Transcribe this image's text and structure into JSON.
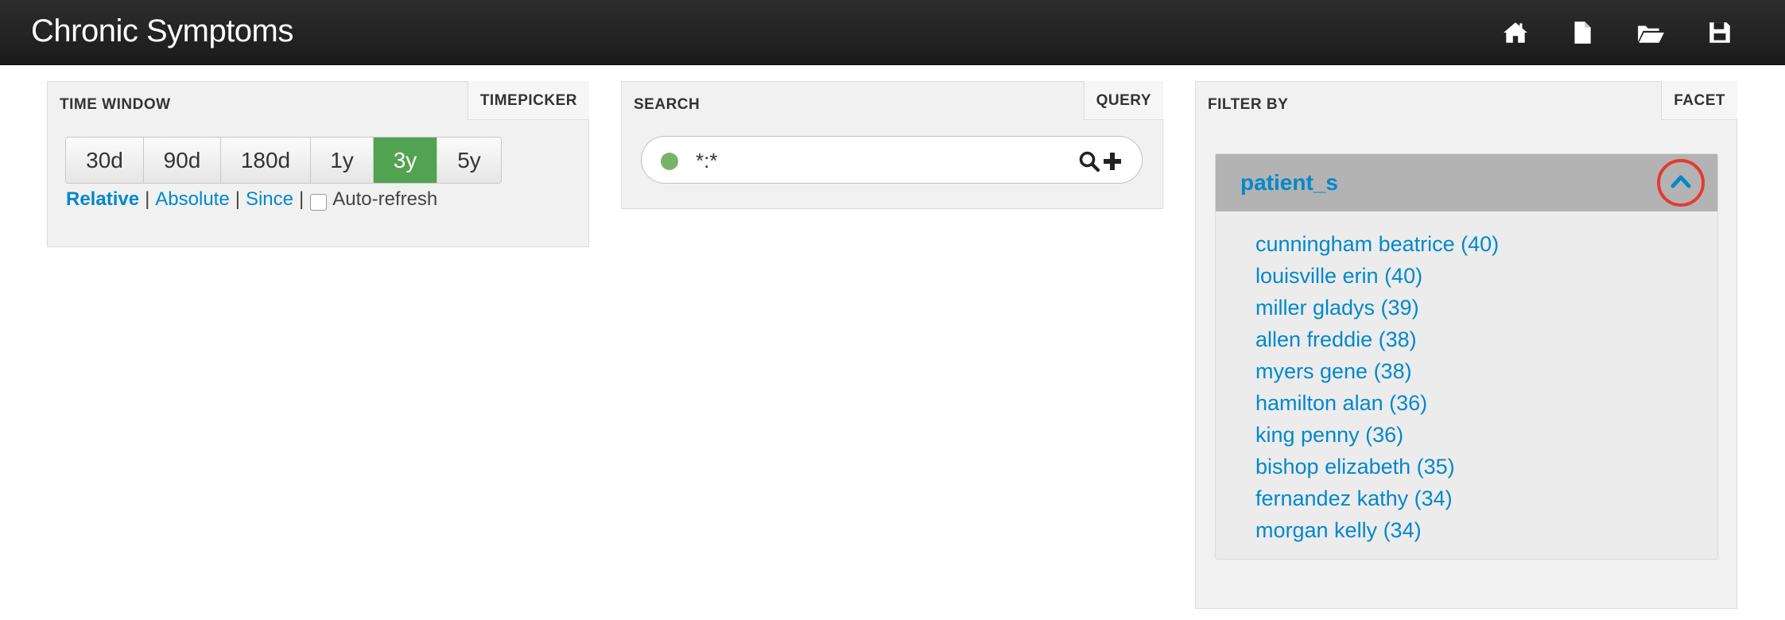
{
  "app": {
    "title": "Chronic Symptoms",
    "nav_icons": [
      "home-icon",
      "new-document-icon",
      "open-folder-icon",
      "save-icon"
    ]
  },
  "timepicker": {
    "title": "TIME WINDOW",
    "tab_label": "TIMEPICKER",
    "buttons": [
      "30d",
      "90d",
      "180d",
      "1y",
      "3y",
      "5y"
    ],
    "active_button": "3y",
    "modes": {
      "relative": "Relative",
      "absolute": "Absolute",
      "since": "Since",
      "separator": "|"
    },
    "auto_refresh_label": "Auto-refresh",
    "auto_refresh_checked": false
  },
  "search": {
    "title": "SEARCH",
    "tab_label": "QUERY",
    "query_value": "*:*",
    "status_color": "#7ab26a",
    "icons": [
      "search-icon",
      "add-query-icon"
    ]
  },
  "filter": {
    "title": "FILTER BY",
    "tab_label": "FACET",
    "facet_field": "patient_s",
    "items": [
      "cunningham beatrice (40)",
      "louisville erin (40)",
      "miller gladys (39)",
      "allen freddie (38)",
      "myers gene (38)",
      "hamilton alan (36)",
      "king penny (36)",
      "bishop elizabeth (35)",
      "fernandez kathy (34)",
      "morgan kelly (34)"
    ]
  },
  "colors": {
    "navbar": "#222222",
    "link": "#0088cc",
    "active_button": "#51a351",
    "highlight_ring": "#e53935"
  }
}
